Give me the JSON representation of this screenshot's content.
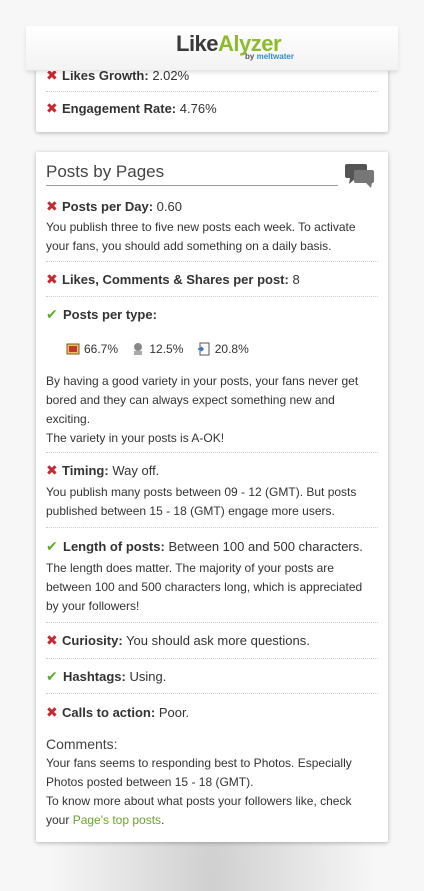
{
  "header": {
    "logo_like": "Like",
    "logo_alyzer": "Alyzer",
    "byline_by": "by",
    "byline_brand": "meltwater"
  },
  "summary": {
    "likes_growth_label": "Likes Growth:",
    "likes_growth_value": "2.02%",
    "engagement_label": "Engagement Rate:",
    "engagement_value": "4.76%"
  },
  "posts": {
    "title": "Posts by Pages",
    "per_day_label": "Posts per Day:",
    "per_day_value": "0.60",
    "per_day_text_1": "You publish three to five new posts each week. To activate",
    "per_day_text_2": "your fans, you should add something on a daily basis.",
    "lcs_label": "Likes, Comments & Shares per post:",
    "lcs_value": "8",
    "type_label": "Posts per type:",
    "types": [
      {
        "icon": "photo-icon",
        "value": "66.7%"
      },
      {
        "icon": "link-icon",
        "value": "12.5%"
      },
      {
        "icon": "status-icon",
        "value": "20.8%"
      }
    ],
    "variety_1": "By having a good variety in your posts, your fans never get",
    "variety_2": "bored and they can always expect something new and",
    "variety_3": "exciting.",
    "variety_4": "The variety in your posts is A-OK!",
    "timing_label": "Timing:",
    "timing_value": "Way off.",
    "timing_1": "You publish many posts between 09 - 12 (GMT). But posts",
    "timing_2": "published between 15 - 18 (GMT) engage more users.",
    "length_label": "Length of posts:",
    "length_value": "Between 100 and 500 characters.",
    "length_1": "The length does matter. The majority of your posts are",
    "length_2": "between 100 and 500 characters long, which is appreciated",
    "length_3": "by your followers!",
    "curiosity_label": "Curiosity:",
    "curiosity_value": "You should ask more questions.",
    "hashtags_label": "Hashtags:",
    "hashtags_value": "Using.",
    "cta_label": "Calls to action:",
    "cta_value": "Poor.",
    "comments_title": "Comments:",
    "comments_1": "Your fans seems to responding best to Photos. Especially",
    "comments_2": "Photos posted between 15 - 18 (GMT).",
    "comments_3": "To know more about what posts your followers like, check",
    "comments_4_prefix": "your",
    "comments_link": "Page's top posts",
    "comments_4_suffix": "."
  },
  "colors": {
    "brand_green": "#8dbb2d",
    "cross_red": "#c8282f",
    "check_green": "#5aae2a",
    "link_green": "#6ba32c"
  }
}
